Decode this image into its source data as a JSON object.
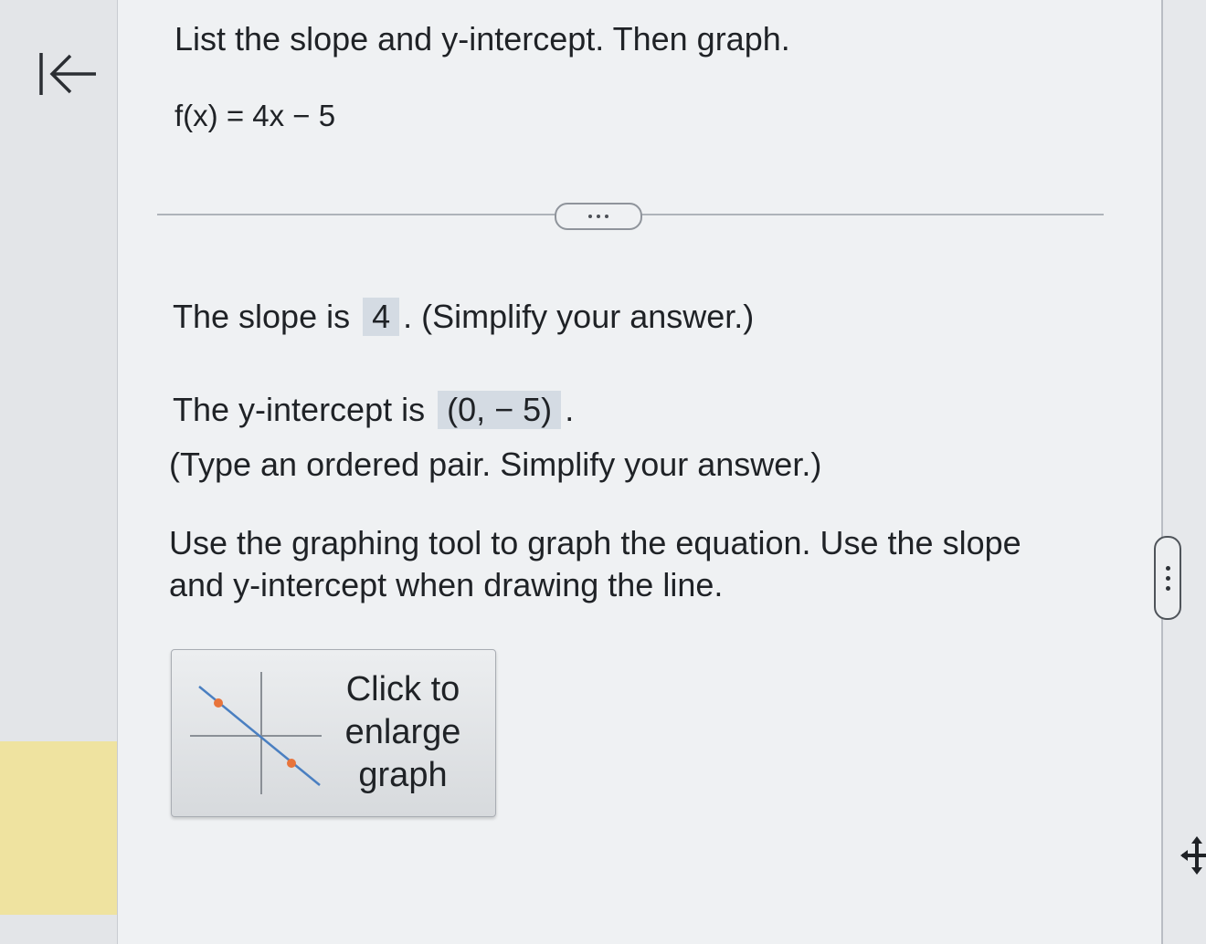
{
  "problem": {
    "instruction": "List the slope and y-intercept. Then graph.",
    "equation": "f(x) = 4x − 5"
  },
  "slope": {
    "prefix": "The slope is",
    "answer": "4",
    "suffix": ". (Simplify your answer.)"
  },
  "intercept": {
    "prefix": "The y-intercept is",
    "answer": "(0, − 5)",
    "suffix": ".",
    "hint": "(Type an ordered pair. Simplify your answer.)"
  },
  "graph_instructions": {
    "line1": "Use the graphing tool to graph the equation. Use the slope",
    "line2": "and y-intercept when drawing the line."
  },
  "graph_button": {
    "line1": "Click to",
    "line2": "enlarge",
    "line3": "graph"
  },
  "icons": {
    "back": "skip-to-start-icon",
    "expand": "more-dots-icon",
    "side": "vertical-dots-icon",
    "move": "move-icon"
  },
  "colors": {
    "answer_highlight": "#d4dbe3",
    "graph_point": "#e8743b",
    "graph_line": "#4a7fc1"
  }
}
